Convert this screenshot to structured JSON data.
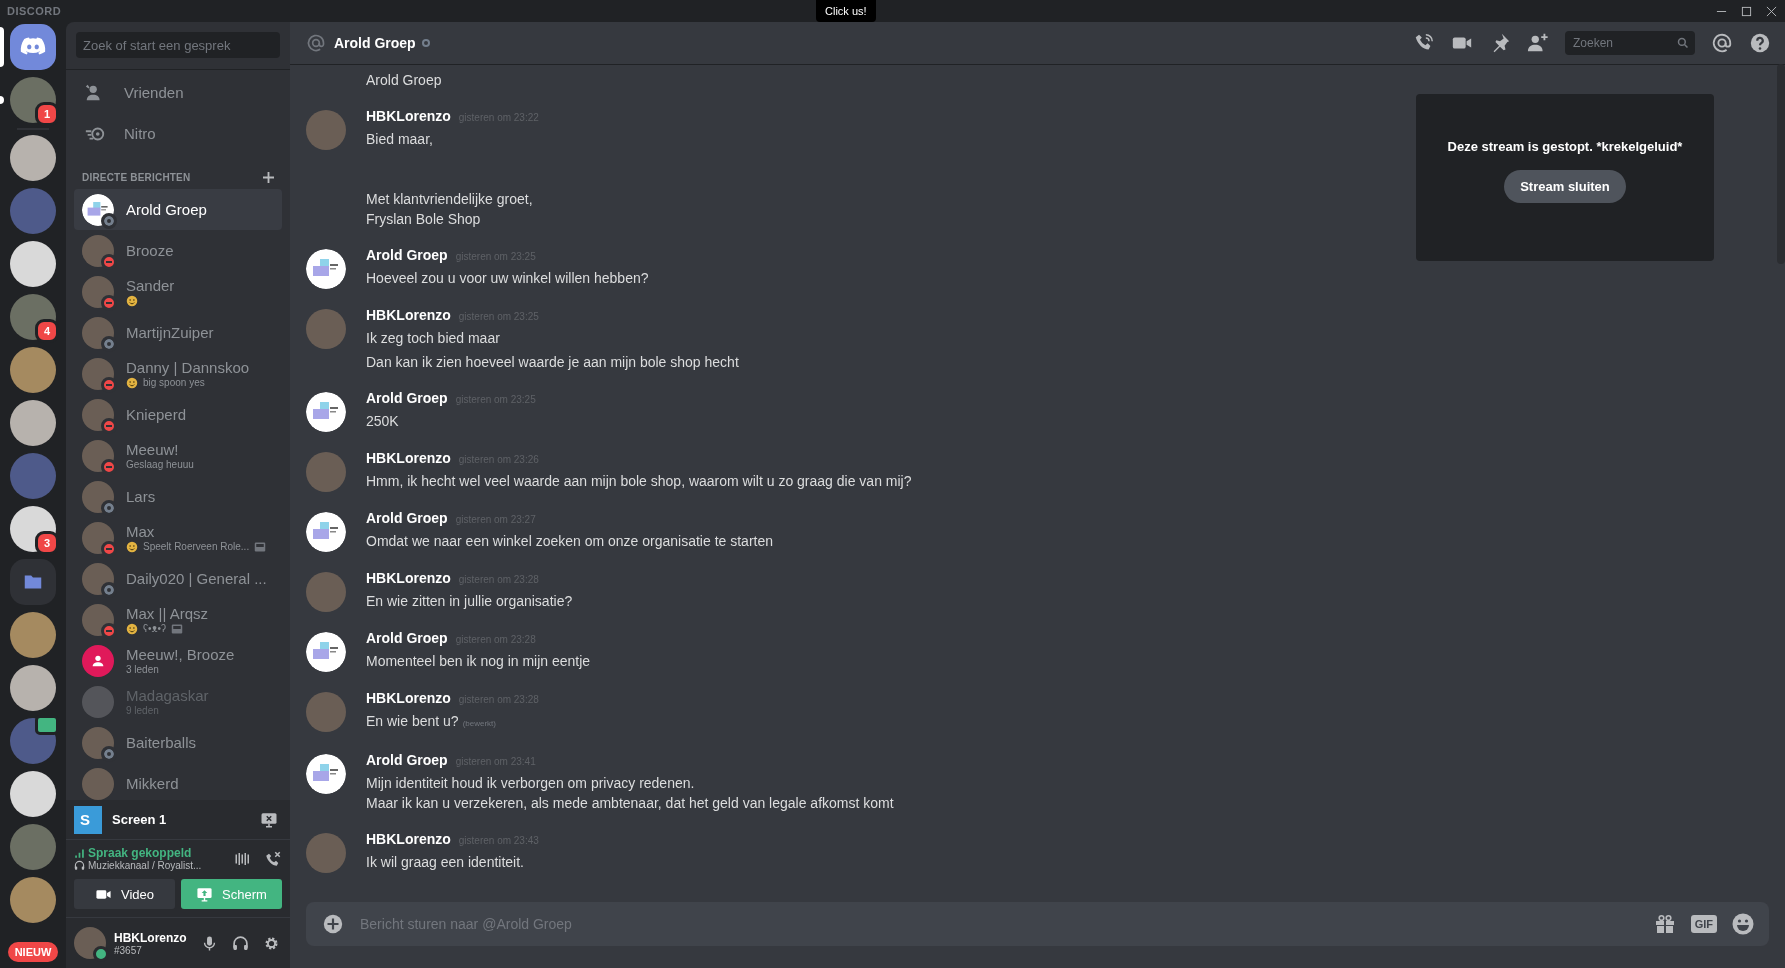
{
  "titlebar": {
    "app_name": "DISCORD",
    "tooltip": "Click us!"
  },
  "servers": [
    {
      "kind": "home",
      "selected": true,
      "unread": false,
      "live": false
    },
    {
      "kind": "server",
      "selected": false,
      "unread": true,
      "live": false,
      "badge": "1"
    },
    {
      "kind": "separator"
    },
    {
      "kind": "server",
      "selected": false,
      "unread": false,
      "live": false
    },
    {
      "kind": "server",
      "selected": false,
      "unread": false,
      "live": false
    },
    {
      "kind": "server",
      "selected": false,
      "unread": false,
      "live": false
    },
    {
      "kind": "server",
      "selected": false,
      "unread": false,
      "live": false,
      "badge": "4"
    },
    {
      "kind": "server",
      "selected": false,
      "unread": false,
      "live": false
    },
    {
      "kind": "server",
      "selected": false,
      "unread": false,
      "live": false
    },
    {
      "kind": "server",
      "selected": false,
      "unread": false,
      "live": false
    },
    {
      "kind": "server",
      "selected": false,
      "unread": false,
      "live": false,
      "badge": "3"
    },
    {
      "kind": "folder",
      "selected": false,
      "unread": false,
      "live": false
    },
    {
      "kind": "server",
      "selected": false,
      "unread": false,
      "live": false
    },
    {
      "kind": "server",
      "selected": false,
      "unread": false,
      "live": false
    },
    {
      "kind": "server",
      "selected": false,
      "unread": false,
      "live": true
    },
    {
      "kind": "server",
      "selected": false,
      "unread": false,
      "live": false
    },
    {
      "kind": "server",
      "selected": false,
      "unread": false,
      "live": false
    },
    {
      "kind": "server",
      "selected": false,
      "unread": false,
      "live": false
    }
  ],
  "new_badge": "NIEUW",
  "dm_search": {
    "placeholder": "Zoek of start een gesprek"
  },
  "nav": [
    {
      "kind": "friends",
      "label": "Vrienden"
    },
    {
      "kind": "nitro",
      "label": "Nitro"
    }
  ],
  "dm_header": "DIRECTE BERICHTEN",
  "dms": [
    {
      "name": "Arold Groep",
      "kind": "logo",
      "offline": true,
      "dnd": false,
      "selected": true,
      "faded": false
    },
    {
      "name": "Brooze",
      "kind": "user",
      "offline": false,
      "dnd": true,
      "selected": false,
      "faded": false
    },
    {
      "name": "Sander",
      "kind": "user",
      "offline": false,
      "dnd": true,
      "selected": false,
      "faded": false,
      "sub": {
        "emoji": true
      }
    },
    {
      "name": "MartijnZuiper",
      "kind": "user",
      "offline": true,
      "dnd": false,
      "selected": false,
      "faded": false
    },
    {
      "name": "Danny | Dannskoo",
      "kind": "user",
      "offline": false,
      "dnd": true,
      "selected": false,
      "faded": false,
      "sub": {
        "emoji": true,
        "text": "big spoon yes"
      }
    },
    {
      "name": "Knieperd",
      "kind": "user",
      "offline": false,
      "dnd": true,
      "selected": false,
      "faded": false
    },
    {
      "name": "Meeuw!",
      "kind": "user",
      "offline": false,
      "dnd": true,
      "selected": false,
      "faded": false,
      "sub": {
        "text": "Geslaag heuuu"
      }
    },
    {
      "name": "Lars",
      "kind": "user",
      "offline": true,
      "dnd": false,
      "selected": false,
      "faded": false
    },
    {
      "name": "Max",
      "kind": "user",
      "offline": false,
      "dnd": true,
      "selected": false,
      "faded": false,
      "sub": {
        "emoji": true,
        "text": "Speelt Roerveen Role...",
        "presence": true
      }
    },
    {
      "name": "Daily020 | General ...",
      "kind": "user",
      "offline": true,
      "dnd": false,
      "selected": false,
      "faded": false
    },
    {
      "name": "Max || Arqsz",
      "kind": "user",
      "offline": false,
      "dnd": true,
      "selected": false,
      "faded": false,
      "sub": {
        "emoji": true,
        "text": "ʕ•ᴥ•ʔ",
        "presence": true
      }
    },
    {
      "name": "Meeuw!, Brooze",
      "kind": "group",
      "offline": false,
      "dnd": false,
      "selected": false,
      "faded": false,
      "sub": {
        "text": "3 leden"
      }
    },
    {
      "name": "Madagaskar",
      "kind": "group-photo",
      "offline": false,
      "dnd": false,
      "selected": false,
      "faded": true,
      "sub": {
        "text": "9 leden"
      }
    },
    {
      "name": "Baiterballs",
      "kind": "user",
      "offline": true,
      "dnd": false,
      "selected": false,
      "faded": false
    },
    {
      "name": "Mikkerd",
      "kind": "user",
      "offline": false,
      "dnd": false,
      "selected": false,
      "faded": false
    }
  ],
  "stream": {
    "letter": "S",
    "title": "Screen 1"
  },
  "voice": {
    "status": "Spraak gekoppeld",
    "channel": "Muziekkanaal / Royalist..."
  },
  "voice_buttons": [
    {
      "kind": "video",
      "label": "Video"
    },
    {
      "kind": "screen",
      "label": "Scherm"
    }
  ],
  "user": {
    "name": "HBKLorenzo",
    "tag": "#3657",
    "online": true
  },
  "channel": {
    "name": "Arold Groep",
    "offline": true
  },
  "header_search": {
    "placeholder": "Zoeken"
  },
  "messages": [
    {
      "kind": "continuation",
      "texts": [
        "Arold Groep"
      ]
    },
    {
      "kind": "user",
      "author": "HBKLorenzo",
      "time": "gisteren om 23:22",
      "texts": [
        "Bied maar,\n\n\nMet klantvriendelijke groet,\nFryslan Bole Shop"
      ]
    },
    {
      "kind": "logo",
      "author": "Arold Groep",
      "time": "gisteren om 23:25",
      "texts": [
        "Hoeveel zou u voor uw winkel willen hebben?"
      ]
    },
    {
      "kind": "user",
      "author": "HBKLorenzo",
      "time": "gisteren om 23:25",
      "texts": [
        "Ik zeg toch bied maar",
        "Dan kan ik zien hoeveel waarde je aan mijn bole shop hecht"
      ]
    },
    {
      "kind": "logo",
      "author": "Arold Groep",
      "time": "gisteren om 23:25",
      "texts": [
        "250K"
      ]
    },
    {
      "kind": "user",
      "author": "HBKLorenzo",
      "time": "gisteren om 23:26",
      "texts": [
        "Hmm, ik hecht wel veel waarde aan mijn bole shop, waarom wilt u zo graag die van mij?"
      ]
    },
    {
      "kind": "logo",
      "author": "Arold Groep",
      "time": "gisteren om 23:27",
      "texts": [
        "Omdat we naar een winkel zoeken om onze organisatie te starten"
      ]
    },
    {
      "kind": "user",
      "author": "HBKLorenzo",
      "time": "gisteren om 23:28",
      "texts": [
        "En wie zitten in jullie organisatie?"
      ]
    },
    {
      "kind": "logo",
      "author": "Arold Groep",
      "time": "gisteren om 23:28",
      "texts": [
        "Momenteel ben ik nog in mijn eentje"
      ]
    },
    {
      "kind": "user",
      "author": "HBKLorenzo",
      "time": "gisteren om 23:28",
      "texts": [
        "En wie bent u?"
      ],
      "edited": "(bewerkt)"
    },
    {
      "kind": "logo",
      "author": "Arold Groep",
      "time": "gisteren om 23:41",
      "texts": [
        "Mijn identiteit houd ik verborgen om privacy redenen.\nMaar ik kan u verzekeren, als mede ambtenaar, dat het geld van legale afkomst komt"
      ]
    },
    {
      "kind": "user",
      "author": "HBKLorenzo",
      "time": "gisteren om 23:43",
      "texts": [
        "Ik wil graag een identiteit."
      ]
    }
  ],
  "stream_notice": {
    "text": "Deze stream is gestopt. *krekelgeluid*",
    "button": "Stream sluiten"
  },
  "composer": {
    "placeholder": "Bericht sturen naar @Arold Groep",
    "gif_label": "GIF"
  }
}
